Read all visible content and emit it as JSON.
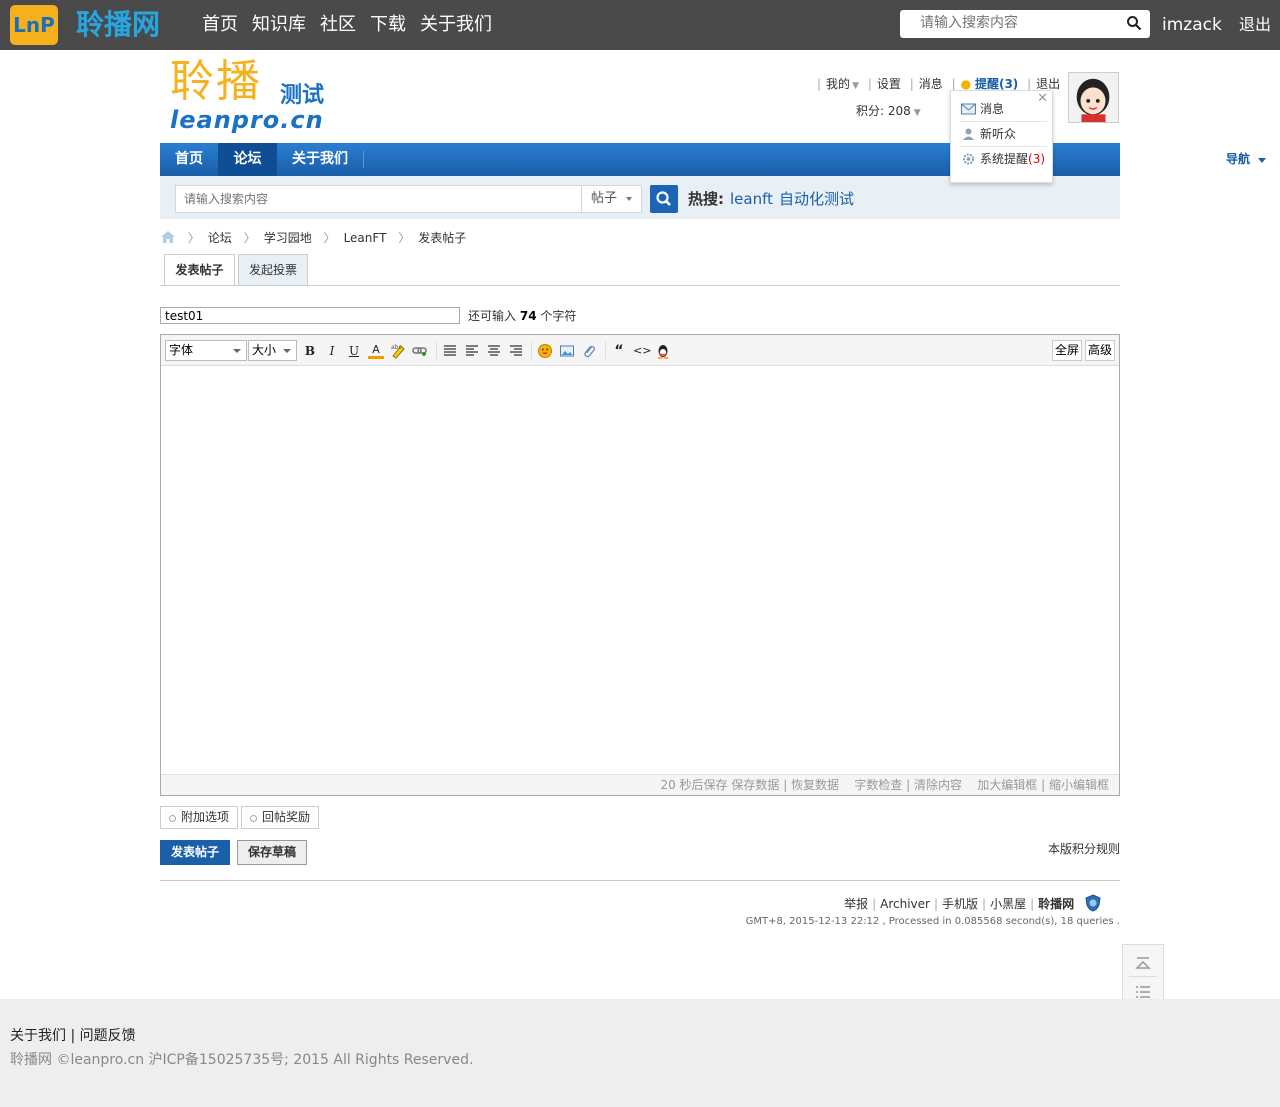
{
  "topbar": {
    "logo_text": "LnP",
    "site_name": "聆播网",
    "nav": [
      "首页",
      "知识库",
      "社区",
      "下载",
      "关于我们"
    ],
    "search_placeholder": "请输入搜索内容",
    "username": "imzack",
    "logout": "退出"
  },
  "brand": {
    "cn": "聆播",
    "test": "测试",
    "en": "leanpro.cn"
  },
  "userlinks": {
    "mine": "我的",
    "settings": "设置",
    "messages": "消息",
    "remind": "提醒(3)",
    "logout": "退出",
    "points": "积分: 208"
  },
  "popup": {
    "items": [
      "消息",
      "新听众",
      "系统提醒"
    ],
    "system_count": "(3)"
  },
  "nav": {
    "items": [
      "首页",
      "论坛",
      "关于我们"
    ],
    "quick_nav": "导航"
  },
  "search": {
    "placeholder": "请输入搜索内容",
    "type": "帖子",
    "hot_label": "热搜:",
    "hot_keywords": [
      "leanft",
      "自动化测试"
    ]
  },
  "breadcrumb": [
    "论坛",
    "学习园地",
    "LeanFT",
    "发表帖子"
  ],
  "tabs": [
    "发表帖子",
    "发起投票"
  ],
  "subject": {
    "value": "test01",
    "remain_prefix": "还可输入",
    "remain_count": "74",
    "remain_suffix": "个字符"
  },
  "editor": {
    "font_select": "字体",
    "size_select": "大小",
    "fullscreen": "全屏",
    "advanced": "高级",
    "status": {
      "autosave": "20 秒后保存",
      "save": "保存数据",
      "restore": "恢复数据",
      "check": "字数检查",
      "clear": "清除内容",
      "enlarge": "加大编辑框",
      "shrink": "缩小编辑框"
    }
  },
  "options": [
    "附加选项",
    "回帖奖励"
  ],
  "actions": {
    "submit": "发表帖子",
    "draft": "保存草稿",
    "rules": "本版积分规则"
  },
  "footer": {
    "links": [
      "举报",
      "Archiver",
      "手机版",
      "小黑屋",
      "聆播网"
    ],
    "gmt": "GMT+8, 2015-12-13 22:12 , Processed in 0.085568 second(s), 18 queries ."
  },
  "bottom": {
    "about": "关于我们",
    "feedback": "问题反馈",
    "copyright": "聆播网 ©leanpro.cn 沪ICP备15025735号; 2015 All Rights Reserved."
  }
}
